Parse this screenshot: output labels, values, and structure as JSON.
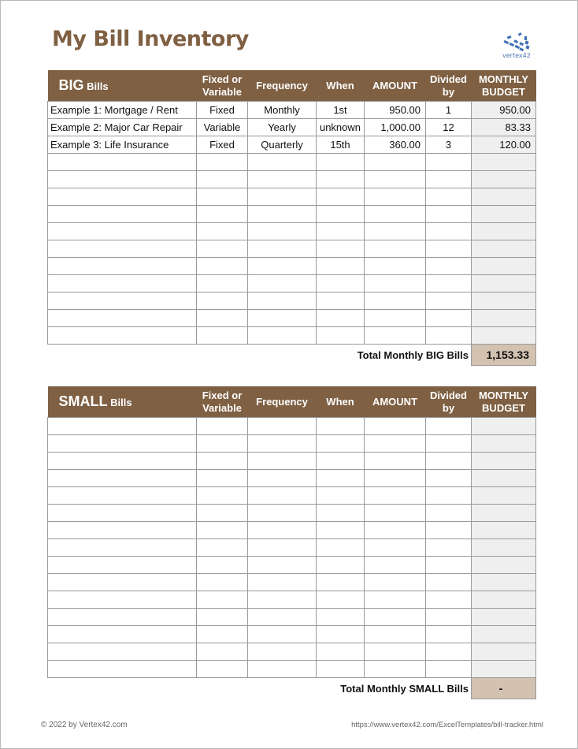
{
  "title": "My Bill Inventory",
  "logo": {
    "text": "vertex42",
    "icon": "vertex42-logo-icon"
  },
  "columns": {
    "fixed": [
      "Fixed or",
      "Variable"
    ],
    "frequency": "Frequency",
    "when": "When",
    "amount": "AMOUNT",
    "divided": [
      "Divided",
      "by"
    ],
    "monthly": [
      "MONTHLY",
      "BUDGET"
    ]
  },
  "big": {
    "heading_main": "BIG",
    "heading_sub": "Bills",
    "rows": [
      {
        "name": "Example 1: Mortgage / Rent",
        "type": "Fixed",
        "frequency": "Monthly",
        "when": "1st",
        "amount": "950.00",
        "divided": "1",
        "monthly": "950.00"
      },
      {
        "name": "Example 2: Major Car Repair",
        "type": "Variable",
        "frequency": "Yearly",
        "when": "unknown",
        "amount": "1,000.00",
        "divided": "12",
        "monthly": "83.33"
      },
      {
        "name": "Example 3: Life Insurance",
        "type": "Fixed",
        "frequency": "Quarterly",
        "when": "15th",
        "amount": "360.00",
        "divided": "3",
        "monthly": "120.00"
      },
      {
        "name": "",
        "type": "",
        "frequency": "",
        "when": "",
        "amount": "",
        "divided": "",
        "monthly": ""
      },
      {
        "name": "",
        "type": "",
        "frequency": "",
        "when": "",
        "amount": "",
        "divided": "",
        "monthly": ""
      },
      {
        "name": "",
        "type": "",
        "frequency": "",
        "when": "",
        "amount": "",
        "divided": "",
        "monthly": ""
      },
      {
        "name": "",
        "type": "",
        "frequency": "",
        "when": "",
        "amount": "",
        "divided": "",
        "monthly": ""
      },
      {
        "name": "",
        "type": "",
        "frequency": "",
        "when": "",
        "amount": "",
        "divided": "",
        "monthly": ""
      },
      {
        "name": "",
        "type": "",
        "frequency": "",
        "when": "",
        "amount": "",
        "divided": "",
        "monthly": ""
      },
      {
        "name": "",
        "type": "",
        "frequency": "",
        "when": "",
        "amount": "",
        "divided": "",
        "monthly": ""
      },
      {
        "name": "",
        "type": "",
        "frequency": "",
        "when": "",
        "amount": "",
        "divided": "",
        "monthly": ""
      },
      {
        "name": "",
        "type": "",
        "frequency": "",
        "when": "",
        "amount": "",
        "divided": "",
        "monthly": ""
      },
      {
        "name": "",
        "type": "",
        "frequency": "",
        "when": "",
        "amount": "",
        "divided": "",
        "monthly": ""
      },
      {
        "name": "",
        "type": "",
        "frequency": "",
        "when": "",
        "amount": "",
        "divided": "",
        "monthly": ""
      }
    ],
    "total_label": "Total Monthly BIG Bills",
    "total_value": "1,153.33"
  },
  "small": {
    "heading_main": "SMALL",
    "heading_sub": "Bills",
    "rows": [
      {
        "name": "",
        "type": "",
        "frequency": "",
        "when": "",
        "amount": "",
        "divided": "",
        "monthly": ""
      },
      {
        "name": "",
        "type": "",
        "frequency": "",
        "when": "",
        "amount": "",
        "divided": "",
        "monthly": ""
      },
      {
        "name": "",
        "type": "",
        "frequency": "",
        "when": "",
        "amount": "",
        "divided": "",
        "monthly": ""
      },
      {
        "name": "",
        "type": "",
        "frequency": "",
        "when": "",
        "amount": "",
        "divided": "",
        "monthly": ""
      },
      {
        "name": "",
        "type": "",
        "frequency": "",
        "when": "",
        "amount": "",
        "divided": "",
        "monthly": ""
      },
      {
        "name": "",
        "type": "",
        "frequency": "",
        "when": "",
        "amount": "",
        "divided": "",
        "monthly": ""
      },
      {
        "name": "",
        "type": "",
        "frequency": "",
        "when": "",
        "amount": "",
        "divided": "",
        "monthly": ""
      },
      {
        "name": "",
        "type": "",
        "frequency": "",
        "when": "",
        "amount": "",
        "divided": "",
        "monthly": ""
      },
      {
        "name": "",
        "type": "",
        "frequency": "",
        "when": "",
        "amount": "",
        "divided": "",
        "monthly": ""
      },
      {
        "name": "",
        "type": "",
        "frequency": "",
        "when": "",
        "amount": "",
        "divided": "",
        "monthly": ""
      },
      {
        "name": "",
        "type": "",
        "frequency": "",
        "when": "",
        "amount": "",
        "divided": "",
        "monthly": ""
      },
      {
        "name": "",
        "type": "",
        "frequency": "",
        "when": "",
        "amount": "",
        "divided": "",
        "monthly": ""
      },
      {
        "name": "",
        "type": "",
        "frequency": "",
        "when": "",
        "amount": "",
        "divided": "",
        "monthly": ""
      },
      {
        "name": "",
        "type": "",
        "frequency": "",
        "when": "",
        "amount": "",
        "divided": "",
        "monthly": ""
      },
      {
        "name": "",
        "type": "",
        "frequency": "",
        "when": "",
        "amount": "",
        "divided": "",
        "monthly": ""
      }
    ],
    "total_label": "Total Monthly SMALL Bills",
    "total_value": "-"
  },
  "footer": {
    "copyright": "© 2022 by Vertex42.com",
    "url": "https://www.vertex42.com/ExcelTemplates/bill-tracker.html"
  }
}
